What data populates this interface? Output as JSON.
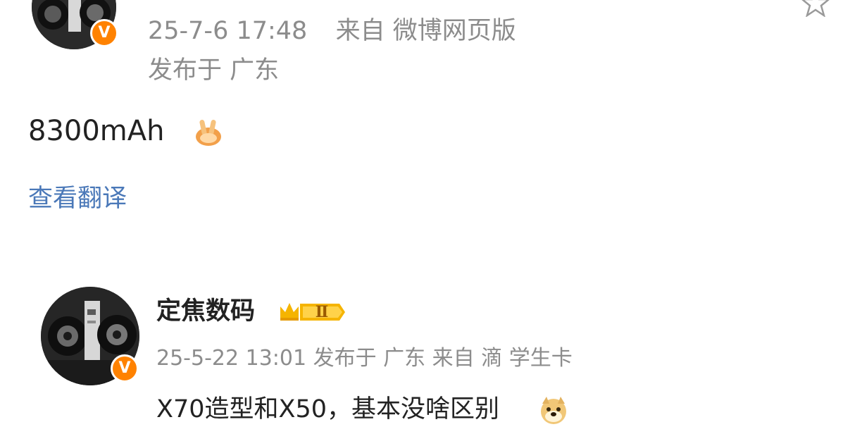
{
  "posts": [
    {
      "avatar": "camera-avatar",
      "verified": "V",
      "timestamp": "25-7-6 17:48",
      "source": "来自 微博网页版",
      "location": "发布于 广东",
      "content": "8300mAh",
      "emoji": "victory-hand-emoji",
      "translate_link": "查看翻译",
      "bookmark_icon": "star-outline-icon"
    },
    {
      "avatar": "camera-avatar",
      "verified": "V",
      "username": "定焦数码",
      "member_badge": "Ⅱ",
      "member_badge_icon": "crown-icon",
      "meta": "25-5-22 13:01 发布于 广东 来自 滴 学生卡",
      "content": "X70造型和X50，基本没啥区别",
      "emoji": "doge-emoji"
    }
  ],
  "colors": {
    "meta_text": "#8c8c8c",
    "link": "#4a78b8",
    "verified_badge": "#ff8200",
    "member_badge": "#f5b400"
  }
}
